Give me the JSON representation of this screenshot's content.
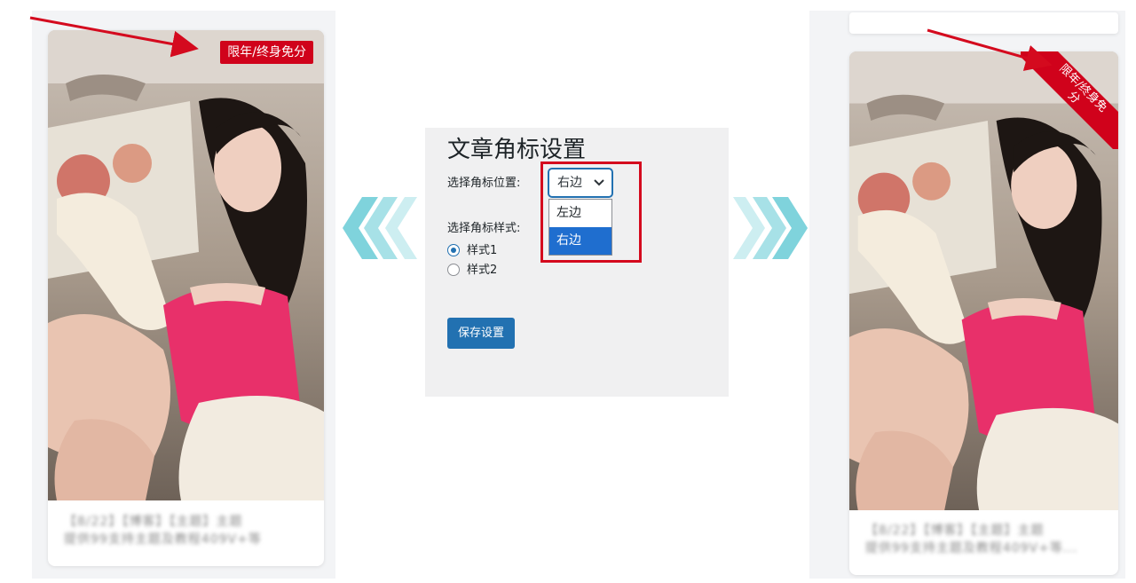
{
  "colors": {
    "badge_red": "#d0021b",
    "annotation_red": "#d40a1e",
    "wp_blue": "#2271b1",
    "chevron_cyan": "#7fd3dc"
  },
  "left_card": {
    "badge_text": "限年/终身免分",
    "caption_lines": [
      "【8/22】【博客】【主题】主题",
      "提供99支持主题及教程409V+等"
    ]
  },
  "right_card": {
    "ribbon_text": "限年/终身免分",
    "caption_lines": [
      "【8/22】【博客】【主题】主题",
      "提供99支持主题及教程409V+等..."
    ]
  },
  "settings": {
    "title": "文章角标设置",
    "position_label": "选择角标位置:",
    "position_value": "右边",
    "position_options": [
      {
        "label": "左边",
        "selected": false
      },
      {
        "label": "右边",
        "selected": true
      }
    ],
    "style_label": "选择角标样式:",
    "style_options": [
      {
        "label": "样式1",
        "checked": true
      },
      {
        "label": "样式2",
        "checked": false
      }
    ],
    "save_label": "保存设置"
  },
  "icons": {
    "left_chevrons": "double-chevron-left-icon",
    "right_chevrons": "double-chevron-right-icon",
    "select_caret": "chevron-down-icon"
  }
}
